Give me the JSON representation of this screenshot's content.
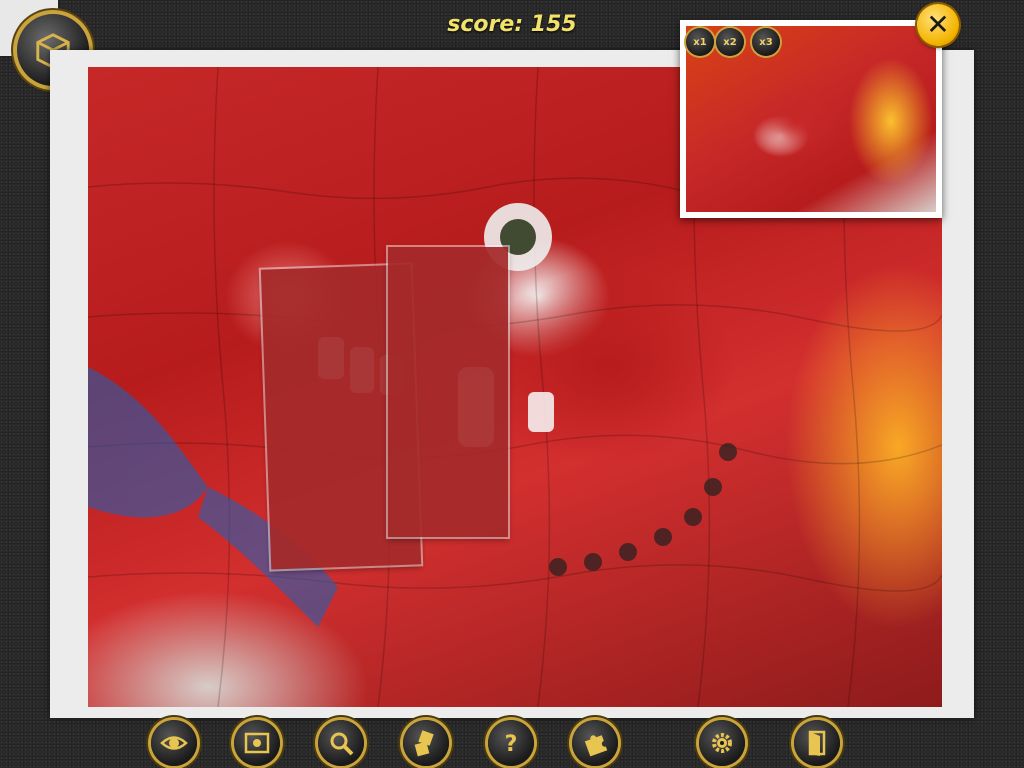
{
  "hud": {
    "score_text": "score: 155"
  },
  "preview": {
    "zoom_buttons": [
      {
        "label": "x1"
      },
      {
        "label": "x2"
      },
      {
        "label": "x3"
      }
    ]
  },
  "icons": {
    "logo": "box-icon",
    "close": "close-icon",
    "toolbar": [
      "eye-icon",
      "picture-icon",
      "magnifier-icon",
      "pieces-sort-icon",
      "help-icon",
      "puzzle-piece-icon",
      "settings-gear-icon",
      "exit-door-icon"
    ]
  },
  "colors": {
    "accent_gold": "#c9a33c",
    "score_yellow": "#f2e26a",
    "close_yellow": "#f4b400",
    "background": "#2b2b2b"
  }
}
